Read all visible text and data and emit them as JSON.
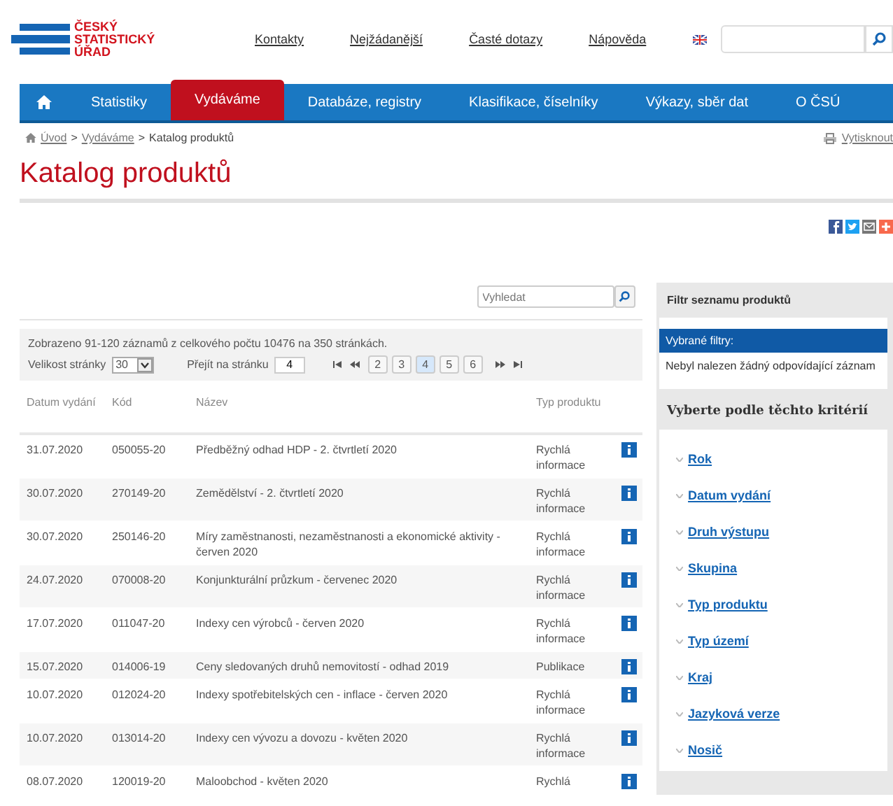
{
  "header": {
    "logo": [
      "ČESKÝ",
      "STATISTICKÝ",
      "ÚŘAD"
    ],
    "links": [
      "Kontakty",
      "Nejžádanější",
      "Časté dotazy",
      "Nápověda"
    ]
  },
  "nav": {
    "home_selected": false,
    "items": [
      {
        "label": "Statistiky",
        "selected": false
      },
      {
        "label": "Vydáváme",
        "selected": true
      },
      {
        "label": "Databáze, registry",
        "selected": false
      },
      {
        "label": "Klasifikace, číselníky",
        "selected": false
      },
      {
        "label": "Výkazy, sběr dat",
        "selected": false
      },
      {
        "label": "O ČSÚ",
        "selected": false
      }
    ]
  },
  "breadcrumb": {
    "separator": ">",
    "items": [
      {
        "label": "Úvod",
        "link": true
      },
      {
        "label": "Vydáváme",
        "link": true
      },
      {
        "label": "Katalog produktů",
        "link": false
      }
    ],
    "print": "Vytisknout"
  },
  "title": "Katalog produktů",
  "search": {
    "placeholder": "Vyhledat"
  },
  "pager": {
    "summary": "Zobrazeno 91-120 záznamů z celkového počtu 10476 na 350 stránkách.",
    "page_size_label": "Velikost stránky",
    "page_size": "30",
    "goto_label": "Přejít na stránku",
    "goto_value": "4",
    "pages": [
      {
        "label": "2",
        "selected": false
      },
      {
        "label": "3",
        "selected": false
      },
      {
        "label": "4",
        "selected": true
      },
      {
        "label": "5",
        "selected": false
      },
      {
        "label": "6",
        "selected": false
      }
    ]
  },
  "table": {
    "columns": [
      "Datum vydání",
      "Kód",
      "Název",
      "Typ produktu"
    ],
    "rows": [
      {
        "date": "31.07.2020",
        "code": "050055-20",
        "name": "Předběžný odhad HDP - 2. čtvrtletí 2020",
        "type": "Rychlá informace"
      },
      {
        "date": "30.07.2020",
        "code": "270149-20",
        "name": "Zemědělství - 2. čtvrtletí 2020",
        "type": "Rychlá informace"
      },
      {
        "date": "30.07.2020",
        "code": "250146-20",
        "name": "Míry zaměstnanosti, nezaměstnanosti a ekonomické aktivity - červen 2020",
        "type": "Rychlá informace"
      },
      {
        "date": "24.07.2020",
        "code": "070008-20",
        "name": "Konjunkturální průzkum - červenec 2020",
        "type": "Rychlá informace"
      },
      {
        "date": "17.07.2020",
        "code": "011047-20",
        "name": "Indexy cen výrobců - červen 2020",
        "type": "Rychlá informace"
      },
      {
        "date": "15.07.2020",
        "code": "014006-19",
        "name": "Ceny sledovaných druhů nemovitostí - odhad 2019",
        "type": "Publikace"
      },
      {
        "date": "10.07.2020",
        "code": "012024-20",
        "name": "Indexy spotřebitelských cen - inflace - červen 2020",
        "type": "Rychlá informace"
      },
      {
        "date": "10.07.2020",
        "code": "013014-20",
        "name": "Indexy cen vývozu a dovozu - květen 2020",
        "type": "Rychlá informace"
      },
      {
        "date": "08.07.2020",
        "code": "120019-20",
        "name": "Maloobchod - květen 2020",
        "type": "Rychlá"
      }
    ]
  },
  "sidebar": {
    "title": "Filtr seznamu produktů",
    "selected_title": "Vybrané filtry:",
    "empty_text": "Nebyl nalezen žádný odpovídající záznam",
    "criteria_title": "Vyberte podle těchto kritérií",
    "criteria": [
      "Rok",
      "Datum vydání",
      "Druh výstupu",
      "Skupina",
      "Typ produktu",
      "Typ území",
      "Kraj",
      "Jazyková verze",
      "Nosič"
    ]
  }
}
